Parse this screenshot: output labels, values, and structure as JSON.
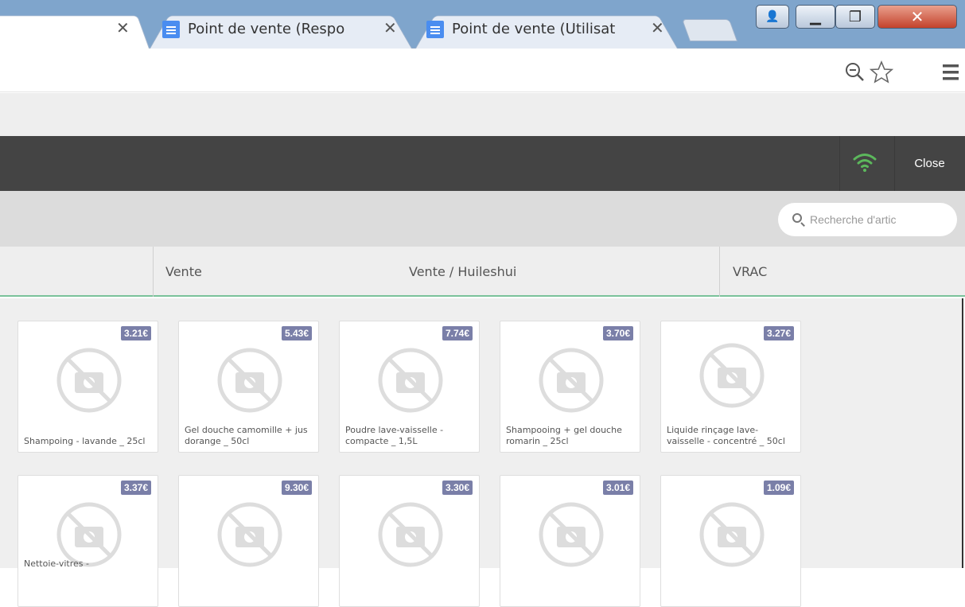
{
  "browser": {
    "tabs": [
      {
        "title": "",
        "active": true
      },
      {
        "title": "Point de vente (Respo",
        "active": false
      },
      {
        "title": "Point de vente (Utilisat",
        "active": false
      }
    ],
    "close_glyph": "✕",
    "window_buttons": {
      "user": "👤",
      "minimize": "▁",
      "restore": "❐",
      "close": "✕"
    },
    "toolbar_icons": {
      "zoom": "magnifier-minus-icon",
      "bookmark": "star-icon",
      "menu": "hamburger-icon"
    }
  },
  "pos": {
    "close_label": "Close",
    "wifi_color": "#5cb85c",
    "search": {
      "placeholder": "Recherche d'artic"
    },
    "categories": [
      "Vente",
      "Vente / Huileshui",
      "VRAC"
    ],
    "products": [
      {
        "price": "3.21€",
        "name": "Shampoing - lavande _ 25cl"
      },
      {
        "price": "5.43€",
        "name": "Gel douche camomille + jus dorange _ 50cl"
      },
      {
        "price": "7.74€",
        "name": "Poudre lave-vaisselle - compacte _ 1,5L"
      },
      {
        "price": "3.70€",
        "name": "Shampooing + gel douche romarin _ 25cl"
      },
      {
        "price": "3.27€",
        "name": "Liquide rinçage lave-vaisselle - concentré _ 50cl"
      },
      {
        "price": "3.37€",
        "name": "Nettoie-vitres -"
      },
      {
        "price": "9.30€",
        "name": ""
      },
      {
        "price": "3.30€",
        "name": ""
      },
      {
        "price": "3.01€",
        "name": ""
      },
      {
        "price": "1.09€",
        "name": ""
      }
    ]
  },
  "colors": {
    "price_badge": "#7a7fa8",
    "header": "#444444",
    "accent_line": "#7ac29a"
  }
}
